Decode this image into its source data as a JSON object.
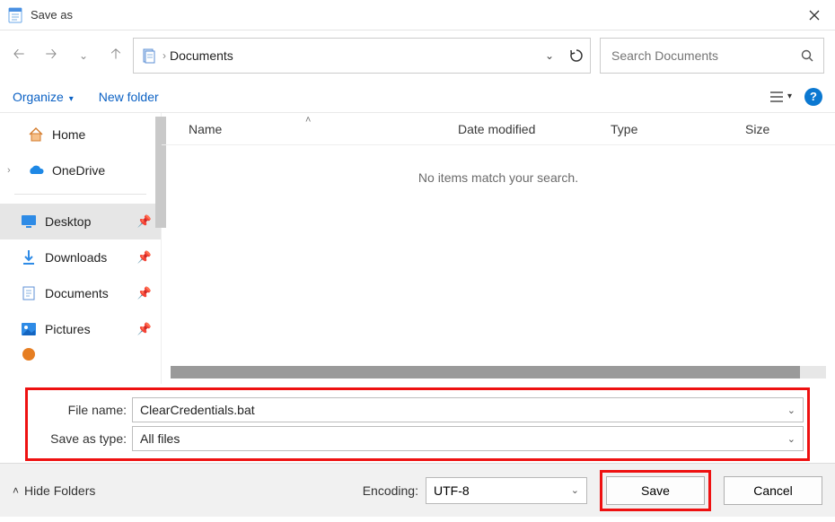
{
  "title": "Save as",
  "breadcrumb": {
    "location": "Documents"
  },
  "search": {
    "placeholder": "Search Documents"
  },
  "toolbar": {
    "organize": "Organize",
    "newfolder": "New folder"
  },
  "sidebar": {
    "home": "Home",
    "onedrive": "OneDrive",
    "desktop": "Desktop",
    "downloads": "Downloads",
    "documents": "Documents",
    "pictures": "Pictures"
  },
  "columns": {
    "name": "Name",
    "date": "Date modified",
    "type": "Type",
    "size": "Size"
  },
  "empty_msg": "No items match your search.",
  "filename": {
    "label": "File name:",
    "value": "ClearCredentials.bat"
  },
  "filetype": {
    "label": "Save as type:",
    "value": "All files"
  },
  "encoding": {
    "label": "Encoding:",
    "value": "UTF-8"
  },
  "buttons": {
    "save": "Save",
    "cancel": "Cancel",
    "hidefolders": "Hide Folders"
  }
}
